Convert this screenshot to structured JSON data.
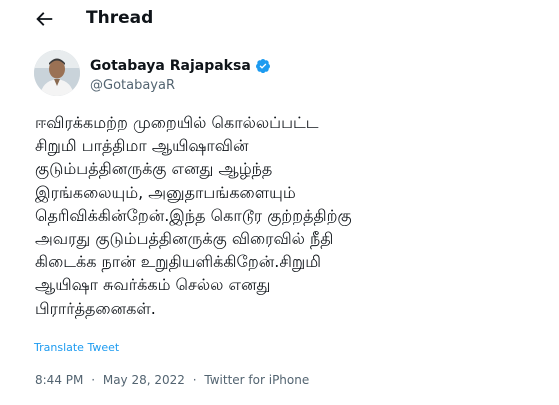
{
  "header": {
    "title": "Thread",
    "back_icon": "arrow-left-icon"
  },
  "author": {
    "name": "Gotabaya Rajapaksa",
    "handle": "@GotabayaR",
    "verified_icon": "verified-badge-icon",
    "verified_color": "#1d9bf0"
  },
  "tweet": {
    "lines": [
      "ஈவிரக்கமற்ற முறையில் கொல்லப்பட்ட",
      "சிறுமி பாத்திமா ஆயிஷாவின்",
      "குடும்பத்தினருக்கு எனது ஆழ்ந்த",
      "இரங்கலையும், அனுதாபங்களையும்",
      "தெரிவிக்கின்றேன்.இந்த கொடூர குற்றத்திற்கு",
      "அவரது குடும்பத்தினருக்கு விரைவில் நீதி",
      "கிடைக்க நான் உறுதியளிக்கிறேன்.சிறுமி",
      "ஆயிஷா சுவர்க்கம் செல்ல எனது",
      "பிரார்த்தனைகள்."
    ],
    "translate_label": "Translate Tweet"
  },
  "meta": {
    "time": "8:44 PM",
    "separator1": "·",
    "date": "May 28, 2022",
    "separator2": "·",
    "source": "Twitter for iPhone"
  },
  "colors": {
    "text": "#0f1419",
    "secondary": "#536471",
    "accent": "#1d9bf0"
  }
}
